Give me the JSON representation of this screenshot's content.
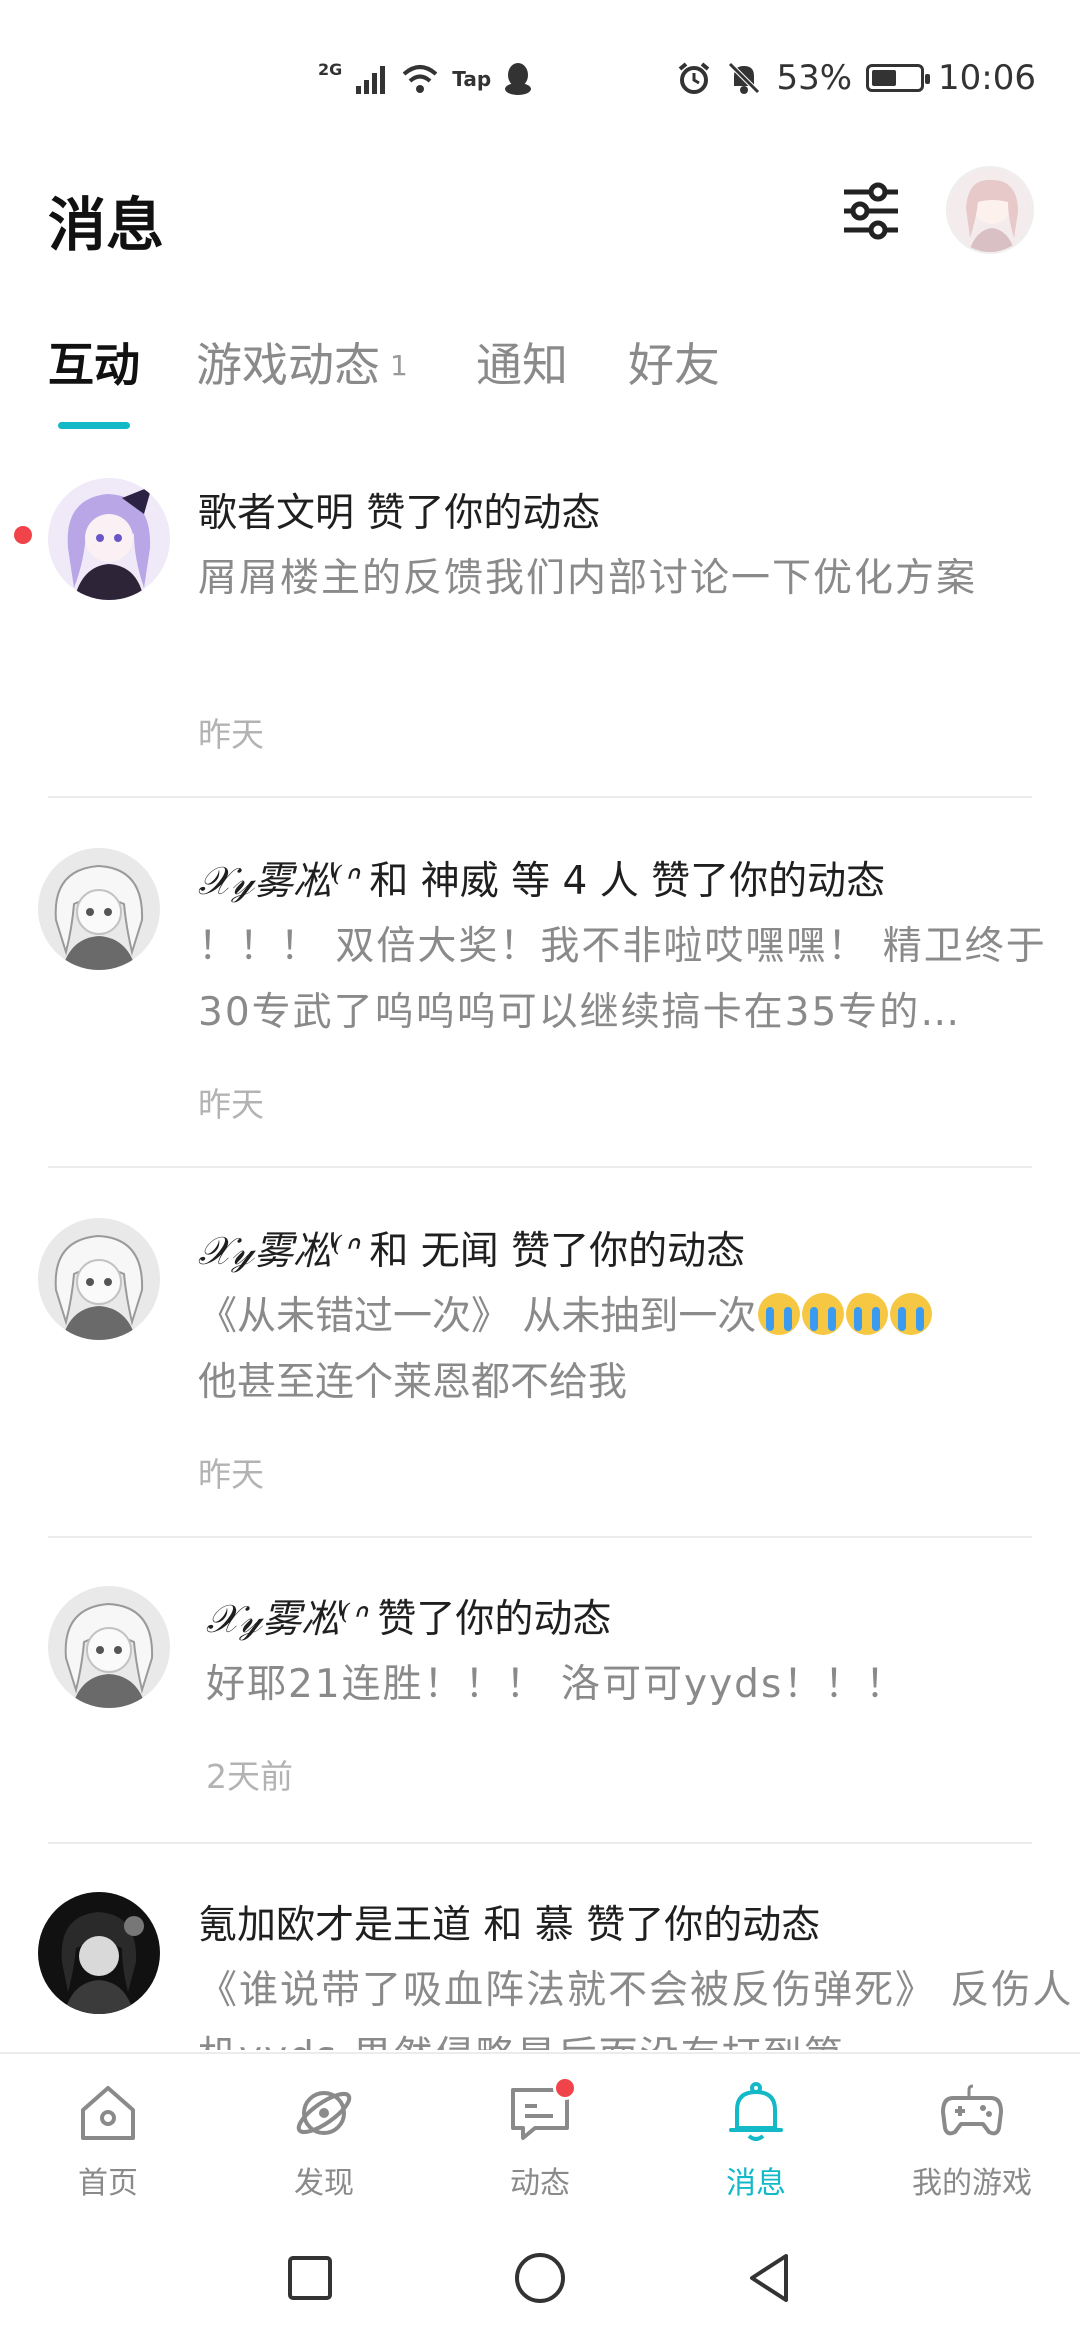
{
  "status_bar": {
    "network": "2G",
    "tap_label": "Tap",
    "battery_text": "53%",
    "battery_level": 0.53,
    "time": "10:06"
  },
  "header": {
    "title": "消息"
  },
  "tabs": [
    {
      "label": "互动",
      "active": true
    },
    {
      "label": "游戏动态",
      "badge": "1",
      "active": false
    },
    {
      "label": "通知",
      "active": false
    },
    {
      "label": "好友",
      "active": false
    }
  ],
  "feed": [
    {
      "title": "歌者文明 赞了你的动态",
      "body": "屑屑楼主的反馈我们内部讨论一下优化方案",
      "time": "昨天",
      "unread": true
    },
    {
      "nick": "𝒳𝓎雾凇⁽ᐢ",
      "title_rest": " 和 神威 等 4 人 赞了你的动态",
      "body": "！！！ 双倍大奖！我不非啦哎嘿嘿！ 精卫终于30专武了呜呜呜可以继续搞卡在35专的…",
      "time": "昨天"
    },
    {
      "nick": "𝒳𝓎雾凇⁽ᐢ",
      "title_rest": " 和 无闻 赞了你的动态",
      "body_line1": "《从未错过一次》 从未抽到一次",
      "body_line2": "他甚至连个莱恩都不给我",
      "time": "昨天"
    },
    {
      "nick": "𝒳𝓎雾凇⁽ᐢ",
      "title_rest": " 赞了你的动态",
      "body": "好耶21连胜！！！ 洛可可yyds！！！",
      "time": "2天前"
    },
    {
      "title": "氪加欧才是王道 和 慕 赞了你的动态",
      "body": "《谁说带了吸血阵法就不会被反伤弹死》 反伤人机yyds 果然侵略是后面没有打到第…"
    }
  ],
  "bottom_nav": [
    {
      "label": "首页",
      "icon": "home-icon",
      "active": false
    },
    {
      "label": "发现",
      "icon": "planet-icon",
      "active": false
    },
    {
      "label": "动态",
      "icon": "chat-icon",
      "active": false,
      "dot": true
    },
    {
      "label": "消息",
      "icon": "bell-icon",
      "active": true
    },
    {
      "label": "我的游戏",
      "icon": "gamepad-icon",
      "active": false
    }
  ],
  "colors": {
    "accent": "#14b9c8",
    "badge_red": "#f0444a",
    "text_primary": "#1f1f1f",
    "text_secondary": "#8a8a8a"
  }
}
